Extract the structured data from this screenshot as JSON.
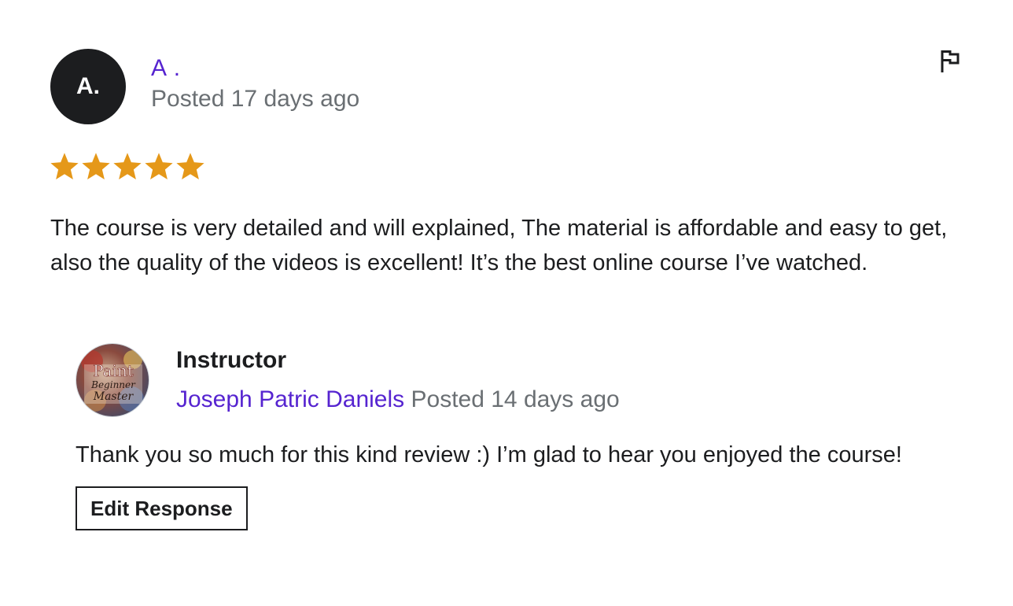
{
  "review": {
    "avatar_initials": "A.",
    "author_name": "A .",
    "posted": "Posted 17 days ago",
    "rating": 5,
    "rating_max": 5,
    "star_color": "#e59819",
    "text": "The course is very detailed and will explained, The material is affordable and easy to get, also the quality of the videos is excellent! It’s the best online course I’ve watched.",
    "flag_icon": "flag-icon"
  },
  "response": {
    "avatar_image_lettering": "Paint Beginner Master",
    "role": "Instructor",
    "instructor_name": "Joseph Patric Daniels",
    "posted": "Posted 14 days ago",
    "text": "Thank you so much for this kind review :) I’m glad to hear you enjoyed the course!",
    "edit_button_label": "Edit Response"
  },
  "colors": {
    "accent": "#5624d0",
    "muted_text": "#6a6f73",
    "text": "#1c1d1f"
  }
}
